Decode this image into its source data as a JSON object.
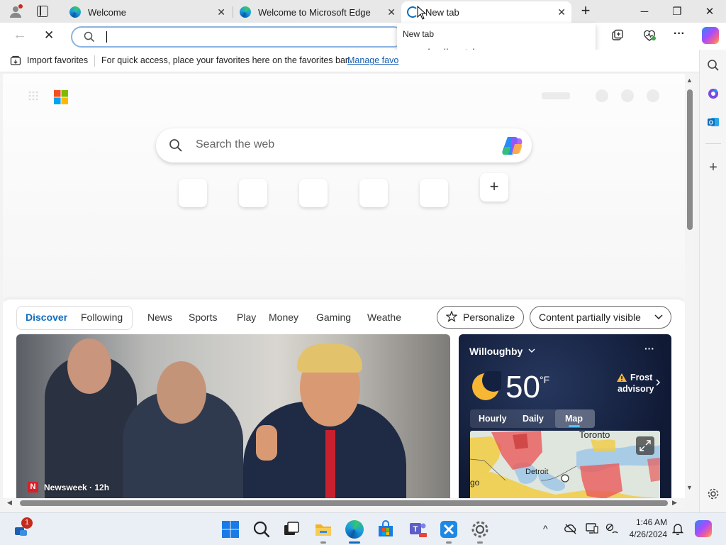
{
  "browser": {
    "tabs": [
      {
        "title": "Welcome"
      },
      {
        "title": "Welcome to Microsoft Edge"
      },
      {
        "title": "New tab"
      }
    ],
    "new_tab_symbol": "+",
    "window_controls": {
      "minimize": "─",
      "restore": "❐",
      "close": "✕"
    }
  },
  "toolbar": {
    "back_symbol": "←",
    "stop_symbol": "✕",
    "address_value": "",
    "more_symbol": "···"
  },
  "autocomplete": {
    "items": [
      "New tab",
      "edge://newtab"
    ]
  },
  "favorites_bar": {
    "import_label": "Import favorites",
    "hint_text": "For quick access, place your favorites here on the favorites bar.",
    "manage_link": "Manage favo"
  },
  "newtab": {
    "search_placeholder": "Search the web",
    "add_symbol": "+"
  },
  "feed": {
    "tabs": [
      "Discover",
      "Following",
      "News",
      "Sports",
      "Play",
      "Money",
      "Gaming",
      "Weathe"
    ],
    "personalize_label": "Personalize",
    "content_visibility_label": "Content partially visible",
    "news_source": "Newsweek · 12h",
    "news_source_badge": "N"
  },
  "weather": {
    "location": "Willoughby",
    "temperature": "50",
    "unit": "°F",
    "alert_line1": "Frost",
    "alert_line2": "advisory",
    "tabs": [
      "Hourly",
      "Daily",
      "Map"
    ],
    "selected_tab": "Map",
    "map_labels": {
      "city1": "Toronto",
      "city2": "Detroit",
      "city3": "go"
    }
  },
  "taskbar": {
    "notification_count": "1",
    "time": "1:46 AM",
    "date": "4/26/2024",
    "chevron_symbol": "^"
  },
  "colors": {
    "accent": "#0f6cbd",
    "link": "#1a5fb4",
    "alert": "#f5b83d",
    "heat_red": "#e85a5a",
    "heat_yellow": "#f2cc43"
  }
}
